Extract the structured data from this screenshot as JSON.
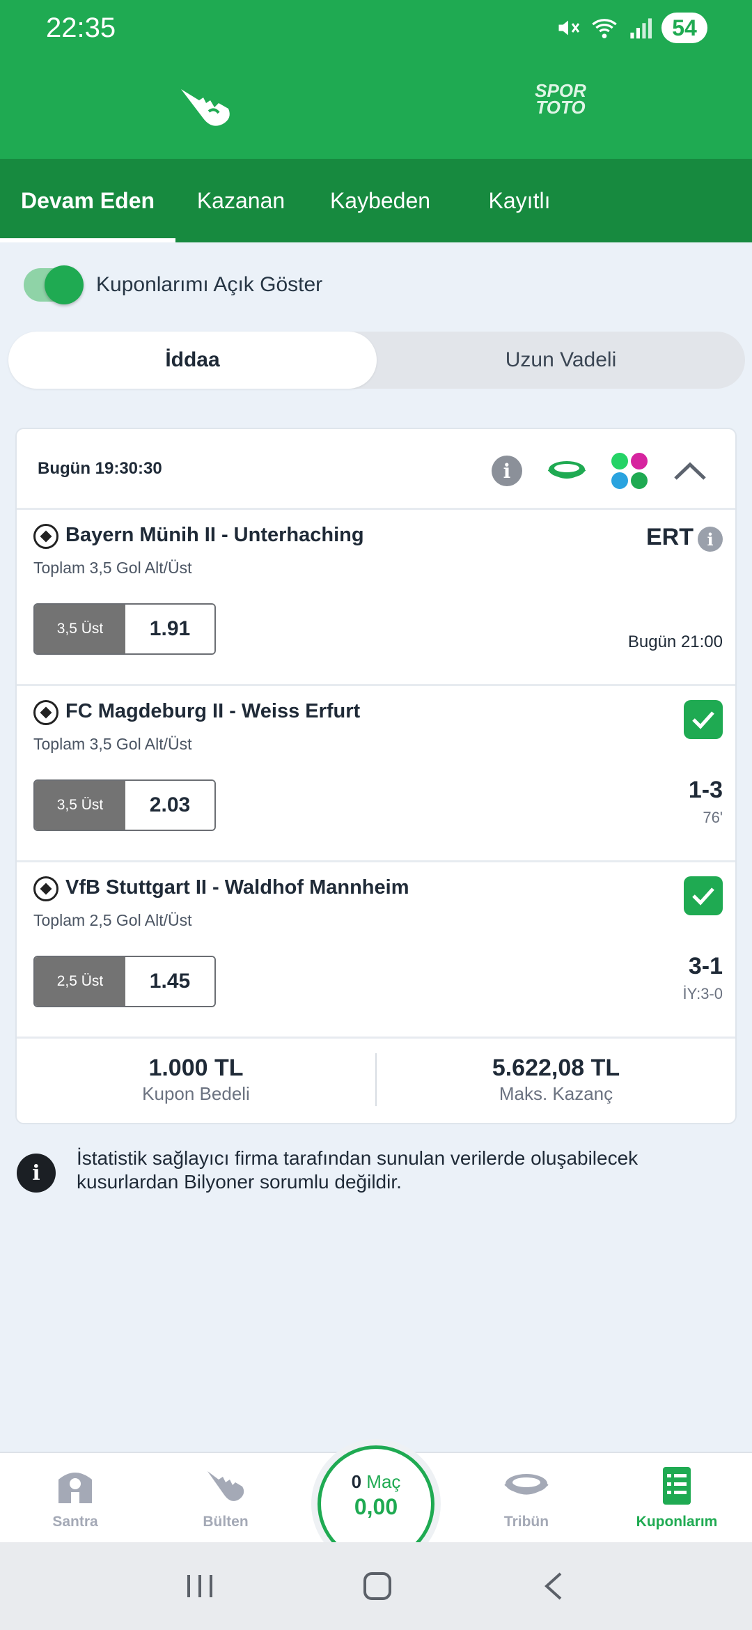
{
  "status_bar": {
    "time": "22:35",
    "battery": "54"
  },
  "header": {
    "sportoto_line1": "SPOR",
    "sportoto_line2": "TOTO"
  },
  "tabs": [
    {
      "label": "Devam Eden",
      "active": true
    },
    {
      "label": "Kazanan"
    },
    {
      "label": "Kaybeden"
    },
    {
      "label": "Kayıtlı"
    }
  ],
  "toggle": {
    "label": "Kuponlarımı Açık Göster",
    "on": true
  },
  "segmented": {
    "left": "İddaa",
    "right": "Uzun Vadeli"
  },
  "coupon": {
    "date": "Bugün 19:30:30",
    "matches": [
      {
        "title": "Bayern Münih II - Unterhaching",
        "market": "Toplam 3,5 Gol Alt/Üst",
        "pick": "3,5 Üst",
        "odd": "1.91",
        "status": "ERT",
        "time": "Bugün 21:00"
      },
      {
        "title": "FC Magdeburg II - Weiss Erfurt",
        "market": "Toplam 3,5 Gol Alt/Üst",
        "pick": "3,5 Üst",
        "odd": "2.03",
        "score": "1-3",
        "minute": "76'"
      },
      {
        "title": "VfB Stuttgart II - Waldhof Mannheim",
        "market": "Toplam 2,5 Gol Alt/Üst",
        "pick": "2,5 Üst",
        "odd": "1.45",
        "score": "3-1",
        "minute": "İY:3-0"
      }
    ],
    "stake": "1.000 TL",
    "stake_label": "Kupon Bedeli",
    "max_win": "5.622,08 TL",
    "max_win_label": "Maks. Kazanç"
  },
  "disclaimer": "İstatistik sağlayıcı firma tarafından sunulan verilerde oluşabilecek kusurlardan Bilyoner sorumlu değildir.",
  "bottom_nav": {
    "items": [
      "Santra",
      "Bülten",
      "Tribün",
      "Kuponlarım"
    ],
    "center_count": "0",
    "center_label": "Maç",
    "center_amount": "0,00"
  },
  "colors": {
    "brand": "#1faa52",
    "tab_bg": "#178a3f"
  }
}
